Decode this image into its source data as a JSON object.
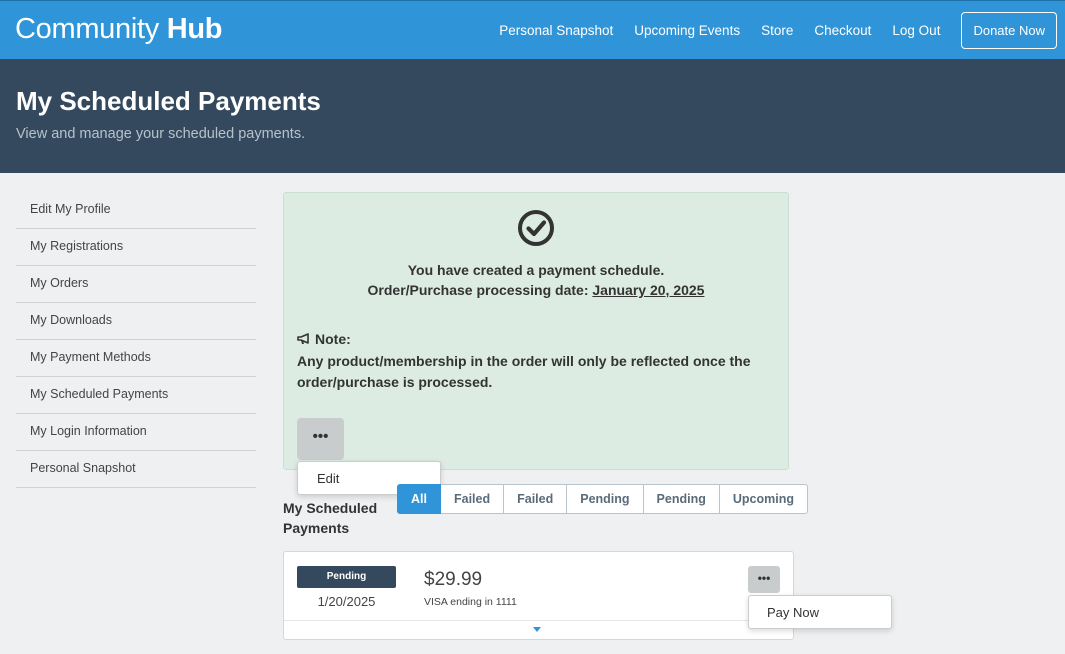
{
  "brand": {
    "light": "Community",
    "bold": "Hub"
  },
  "nav": {
    "links": [
      "Personal Snapshot",
      "Upcoming Events",
      "Store",
      "Checkout",
      "Log Out"
    ],
    "donate": "Donate Now"
  },
  "header": {
    "title": "My Scheduled Payments",
    "subtitle": "View and manage your scheduled payments."
  },
  "sidebar": {
    "items": [
      "Edit My Profile",
      "My Registrations",
      "My Orders",
      "My Downloads",
      "My Payment Methods",
      "My Scheduled Payments",
      "My Login Information",
      "Personal Snapshot"
    ]
  },
  "notice": {
    "line1": "You have created a payment schedule.",
    "line2_prefix": "Order/Purchase processing date: ",
    "date": "January 20, 2025",
    "note_label": "Note:",
    "note_text": "Any product/membership in the order will only be reflected once the order/purchase is processed.",
    "more": "•••",
    "menu_edit": "Edit"
  },
  "payments": {
    "title": "My Scheduled Payments",
    "tabs": [
      "All",
      "Failed",
      "Failed",
      "Pending",
      "Pending",
      "Upcoming"
    ],
    "active_tab": "All",
    "card": {
      "status": "Pending",
      "date": "1/20/2025",
      "amount": "$29.99",
      "method": "VISA ending in 1111",
      "more": "•••",
      "menu_pay": "Pay Now"
    }
  },
  "colors": {
    "primary": "#2f95d8",
    "header": "#34495e",
    "success_bg": "#dcece2"
  }
}
